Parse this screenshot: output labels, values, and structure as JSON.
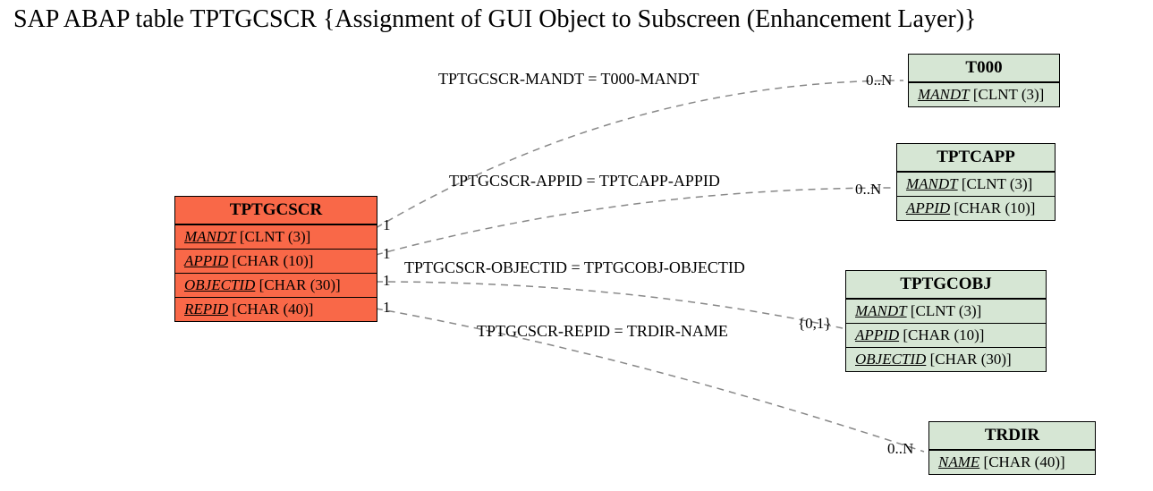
{
  "title": "SAP ABAP table TPTGCSCR {Assignment of GUI Object to Subscreen (Enhancement Layer)}",
  "main": {
    "name": "TPTGCSCR",
    "f0": {
      "n": "MANDT",
      "t": "[CLNT (3)]"
    },
    "f1": {
      "n": "APPID",
      "t": "[CHAR (10)]"
    },
    "f2": {
      "n": "OBJECTID",
      "t": "[CHAR (30)]"
    },
    "f3": {
      "n": "REPID",
      "t": "[CHAR (40)]"
    }
  },
  "t000": {
    "name": "T000",
    "f0": {
      "n": "MANDT",
      "t": "[CLNT (3)]"
    }
  },
  "tptcapp": {
    "name": "TPTCAPP",
    "f0": {
      "n": "MANDT",
      "t": "[CLNT (3)]"
    },
    "f1": {
      "n": "APPID",
      "t": "[CHAR (10)]"
    }
  },
  "tptgcobj": {
    "name": "TPTGCOBJ",
    "f0": {
      "n": "MANDT",
      "t": "[CLNT (3)]"
    },
    "f1": {
      "n": "APPID",
      "t": "[CHAR (10)]"
    },
    "f2": {
      "n": "OBJECTID",
      "t": "[CHAR (30)]"
    }
  },
  "trdir": {
    "name": "TRDIR",
    "f0": {
      "n": "NAME",
      "t": "[CHAR (40)]"
    }
  },
  "rel": {
    "r0": "TPTGCSCR-MANDT = T000-MANDT",
    "r1": "TPTGCSCR-APPID = TPTCAPP-APPID",
    "r2": "TPTGCSCR-OBJECTID = TPTGCOBJ-OBJECTID",
    "r3": "TPTGCSCR-REPID = TRDIR-NAME"
  },
  "card": {
    "one": "1",
    "zn": "0..N",
    "zo": "{0,1}"
  }
}
